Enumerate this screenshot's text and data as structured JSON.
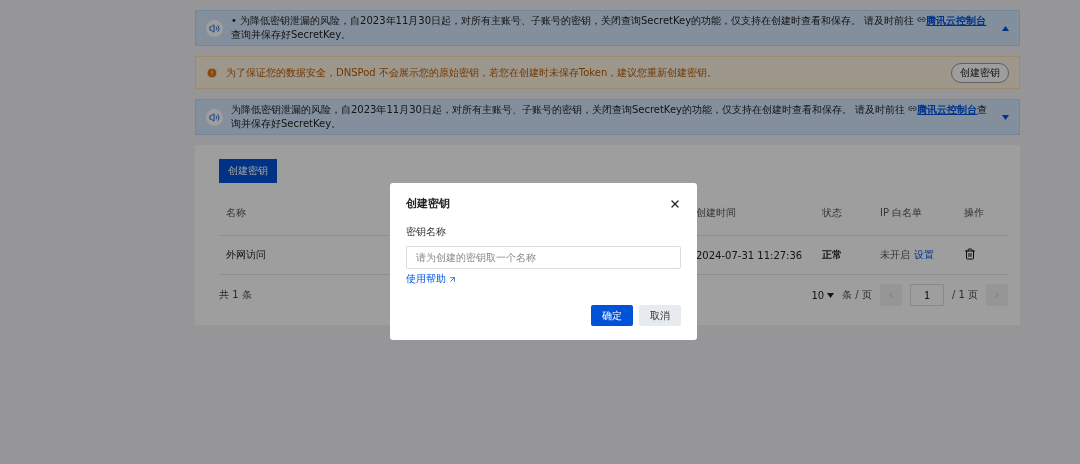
{
  "notices": [
    {
      "kind": "info",
      "bullet": "•",
      "text": "为降低密钥泄漏的风险，自2023年11月30日起，对所有主账号、子账号的密钥，关闭查询SecretKey的功能，仅支持在创建时查看和保存。 请及时前往",
      "link": "腾讯云控制台",
      "after": "查询并保存好SecretKey。",
      "expanded": true
    },
    {
      "kind": "warning",
      "text": "为了保证您的数据安全，DNSPod 不会展示您的原始密钥，若您在创建时未保存Token，建议您重新创建密钥。",
      "button": "创建密钥"
    },
    {
      "kind": "info",
      "text": "为降低密钥泄漏的风险，自2023年11月30日起，对所有主账号、子账号的密钥，关闭查询SecretKey的功能，仅支持在创建时查看和保存。 请及时前往",
      "link": "腾讯云控制台",
      "after": "查询并保存好SecretKey。",
      "expanded": false
    }
  ],
  "create_button": "创建密钥",
  "table": {
    "columns": [
      "名称",
      "创建时间",
      "状态",
      "IP 白名单",
      "操作"
    ],
    "rows": [
      {
        "name": "外网访问",
        "created": "2024-07-31 11:27:36",
        "status": "正常",
        "ip_state": "未开启",
        "ip_action": "设置"
      }
    ]
  },
  "pagination": {
    "total": "共 1 条",
    "page_size": "10",
    "per_page": "条 / 页",
    "page": "1",
    "pages": "/ 1 页"
  },
  "dialog": {
    "title": "创建密钥",
    "field_label": "密钥名称",
    "placeholder": "请为创建的密钥取一个名称",
    "help_link": "使用帮助",
    "confirm": "确定",
    "cancel": "取消"
  }
}
